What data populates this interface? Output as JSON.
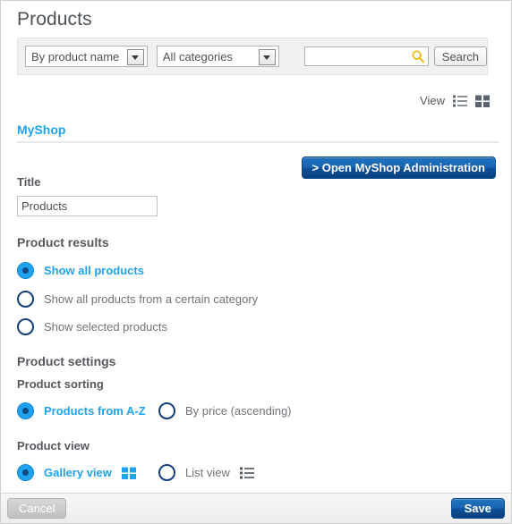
{
  "page": {
    "title": "Products"
  },
  "search_toolbar": {
    "sort_select": {
      "value": "By product name",
      "icon": "chevron-down-icon"
    },
    "category_select": {
      "value": "All categories",
      "icon": "chevron-down-icon"
    },
    "search_field": {
      "value": "",
      "placeholder": "",
      "icon": "search-icon",
      "icon_color": "#f2b40b"
    },
    "search_button": "Search"
  },
  "view_switcher": {
    "label": "View",
    "list_icon": "list-view-icon",
    "grid_icon": "grid-view-icon",
    "icon_color": "#5c6370"
  },
  "myshop": {
    "heading": "MyShop",
    "heading_color": "#1fa3ef",
    "admin_button": "> Open MyShop Administration"
  },
  "title_field": {
    "label": "Title",
    "value": "Products",
    "placeholder": ""
  },
  "product_results": {
    "heading": "Product results",
    "options": [
      {
        "label": "Show all products",
        "selected": true
      },
      {
        "label": "Show all products from a certain category",
        "selected": false
      },
      {
        "label": "Show selected products",
        "selected": false
      }
    ]
  },
  "product_settings": {
    "heading": "Product settings",
    "sorting": {
      "heading": "Product sorting",
      "options": [
        {
          "label": "Products from A-Z",
          "selected": true
        },
        {
          "label": "By price (ascending)",
          "selected": false
        }
      ]
    },
    "view": {
      "heading": "Product view",
      "options": [
        {
          "label": "Gallery view",
          "selected": true,
          "icon": "grid-view-icon",
          "icon_color": "#1fa3ef"
        },
        {
          "label": "List view",
          "selected": false,
          "icon": "list-view-icon",
          "icon_color": "#5c6370"
        }
      ]
    }
  },
  "footer": {
    "cancel_label": "Cancel",
    "save_label": "Save"
  },
  "colors": {
    "accent": "#1fa3ef",
    "primary_button": "#1967b5",
    "radio_ring": "#123f78",
    "text": "#55595d"
  }
}
